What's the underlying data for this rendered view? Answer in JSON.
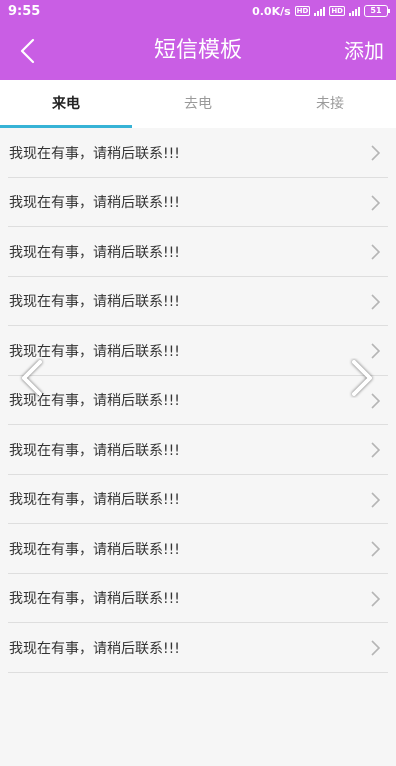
{
  "status_bar": {
    "time": "9:55",
    "speed": "0.0K/s",
    "battery": "51"
  },
  "header": {
    "title": "短信模板",
    "add_label": "添加"
  },
  "tabs": [
    {
      "label": "来电",
      "active": true
    },
    {
      "label": "去电",
      "active": false
    },
    {
      "label": "未接",
      "active": false
    }
  ],
  "templates": [
    {
      "text": "我现在有事，请稍后联系!!!"
    },
    {
      "text": "我现在有事，请稍后联系!!!"
    },
    {
      "text": "我现在有事，请稍后联系!!!"
    },
    {
      "text": "我现在有事，请稍后联系!!!"
    },
    {
      "text": "我现在有事，请稍后联系!!!"
    },
    {
      "text": "我现在有事，请稍后联系!!!"
    },
    {
      "text": "我现在有事，请稍后联系!!!"
    },
    {
      "text": "我现在有事，请稍后联系!!!"
    },
    {
      "text": "我现在有事，请稍后联系!!!"
    },
    {
      "text": "我现在有事，请稍后联系!!!"
    },
    {
      "text": "我现在有事，请稍后联系!!!"
    }
  ],
  "colors": {
    "accent": "#c95ee4",
    "tab_indicator": "#37b3d6"
  }
}
